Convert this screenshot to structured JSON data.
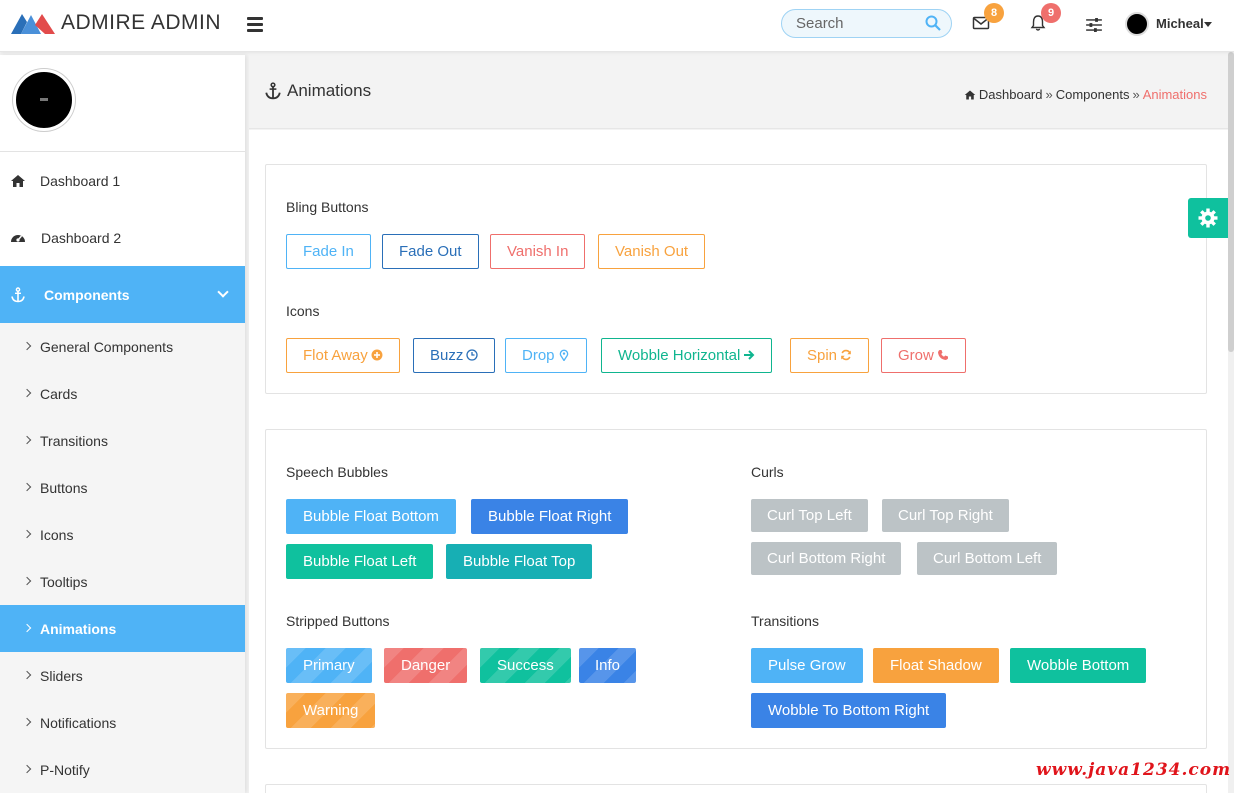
{
  "header": {
    "brand": "ADMIRE ADMIN",
    "search_placeholder": "Search",
    "mail_count": "8",
    "notif_count": "9",
    "user_name": "Micheal",
    "colors": {
      "mail_badge": "#f8a23e",
      "notif_badge": "#ef6f6c",
      "search_accent": "#4fb3f6"
    }
  },
  "sidebar": {
    "items": [
      {
        "label": "Dashboard 1",
        "icon": "home-icon"
      },
      {
        "label": "Dashboard 2",
        "icon": "dashboard-icon"
      },
      {
        "label": "Components",
        "icon": "anchor-icon",
        "active": true
      }
    ],
    "sub_items": [
      {
        "label": "General Components"
      },
      {
        "label": "Cards"
      },
      {
        "label": "Transitions"
      },
      {
        "label": "Buttons"
      },
      {
        "label": "Icons"
      },
      {
        "label": "Tooltips"
      },
      {
        "label": "Animations",
        "active": true
      },
      {
        "label": "Sliders"
      },
      {
        "label": "Notifications"
      },
      {
        "label": "P-Notify"
      }
    ]
  },
  "page": {
    "title": "Animations",
    "breadcrumb": {
      "home": "Dashboard",
      "parent": "Components",
      "current": "Animations"
    }
  },
  "bling": {
    "title": "Bling Buttons",
    "buttons": [
      "Fade In",
      "Fade Out",
      "Vanish In",
      "Vanish Out"
    ]
  },
  "icons_section": {
    "title": "Icons",
    "buttons": [
      "Flot Away",
      "Buzz",
      "Drop",
      "Wobble Horizontal",
      "Spin",
      "Grow"
    ]
  },
  "speech": {
    "title": "Speech Bubbles",
    "buttons": [
      "Bubble Float Bottom",
      "Bubble Float Right",
      "Bubble Float Left",
      "Bubble Float Top"
    ]
  },
  "curls": {
    "title": "Curls",
    "buttons": [
      "Curl Top Left",
      "Curl Top Right",
      "Curl Bottom Right",
      "Curl Bottom Left"
    ]
  },
  "stripped": {
    "title": "Stripped Buttons",
    "buttons": [
      "Primary",
      "Danger",
      "Success",
      "Info",
      "Warning"
    ]
  },
  "transitions": {
    "title": "Transitions",
    "buttons": [
      "Pulse Grow",
      "Float Shadow",
      "Wobble Bottom",
      "Wobble To Bottom Right"
    ]
  },
  "watermark": "www.java1234.com"
}
